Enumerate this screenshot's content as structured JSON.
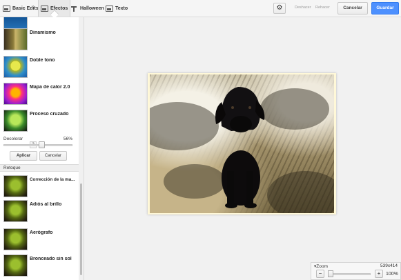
{
  "toolbar": {
    "tabs": [
      {
        "label": "Basic Edits",
        "icon": "basic-edits-icon"
      },
      {
        "label": "Efectos",
        "icon": "effects-icon",
        "active": true
      },
      {
        "label": "Halloween",
        "icon": "halloween-hat-icon"
      },
      {
        "label": "Texto",
        "icon": "text-icon"
      }
    ],
    "undo": "Deshacer",
    "redo": "Rehacer",
    "cancel": "Cancelar",
    "save": "Guardar",
    "save_color": "#4d90fe"
  },
  "effects": [
    {
      "label": "Dinamismo"
    },
    {
      "label": "Doble tono"
    },
    {
      "label": "Mapa de calor 2.0"
    },
    {
      "label": "Proceso cruzado"
    }
  ],
  "settings": {
    "help": "?",
    "slider_label": "Decolorar",
    "slider_value": "56%",
    "slider_fraction": 0.56,
    "apply": "Aplicar",
    "cancel": "Cancelar"
  },
  "retouch": {
    "title": "Retoque",
    "items": [
      {
        "label": "Corrección de la ma..."
      },
      {
        "label": "Adiós al brillo"
      },
      {
        "label": "Aerógrafo"
      },
      {
        "label": "Bronceado sin sol"
      }
    ]
  },
  "zoom": {
    "title": "Zoom",
    "dimensions": "539x414",
    "percent": "100%",
    "minus": "−",
    "plus": "+"
  }
}
